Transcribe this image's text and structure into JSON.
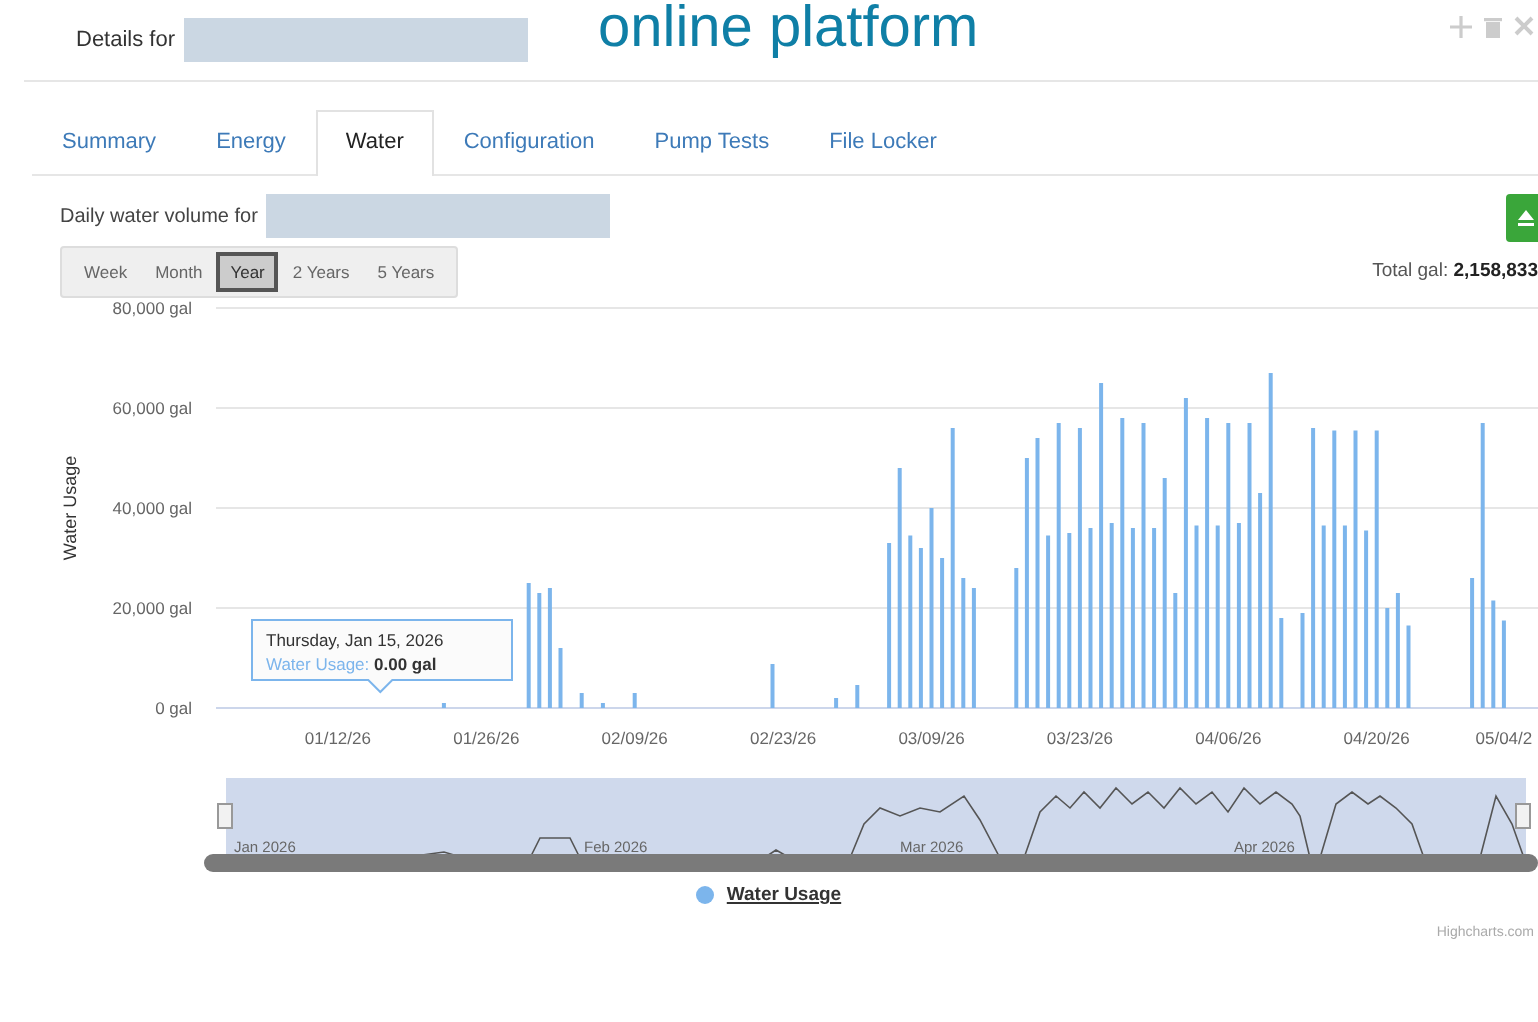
{
  "header": {
    "title": "Details for",
    "overlay_text": "online platform"
  },
  "tabs": [
    {
      "label": "Summary",
      "selected": false
    },
    {
      "label": "Energy",
      "selected": false
    },
    {
      "label": "Water",
      "selected": true
    },
    {
      "label": "Configuration",
      "selected": false
    },
    {
      "label": "Pump Tests",
      "selected": false
    },
    {
      "label": "File Locker",
      "selected": false
    }
  ],
  "subtitle": "Daily water volume for",
  "ranges": [
    {
      "label": "Week",
      "selected": false
    },
    {
      "label": "Month",
      "selected": false
    },
    {
      "label": "Year",
      "selected": true
    },
    {
      "label": "2 Years",
      "selected": false
    },
    {
      "label": "5 Years",
      "selected": false
    }
  ],
  "total": "Total gal: **2,158,833**",
  "chart_data": {
    "type": "bar",
    "ylabel": "Water Usage",
    "ylim": [
      0,
      80000
    ],
    "grid": true,
    "yticks": [
      {
        "value": 0,
        "label": "0 gal"
      },
      {
        "value": 20000,
        "label": "20,000 gal"
      },
      {
        "value": 40000,
        "label": "40,000 gal"
      },
      {
        "value": 60000,
        "label": "60,000 gal"
      },
      {
        "value": 80000,
        "label": "80,000 gal"
      }
    ],
    "categories": [
      null,
      null,
      null,
      null,
      null,
      null,
      null,
      null,
      null,
      null,
      null,
      "01/12/26",
      null,
      null,
      null,
      null,
      null,
      null,
      null,
      null,
      null,
      null,
      null,
      null,
      null,
      "01/26/26",
      null,
      null,
      null,
      null,
      null,
      null,
      null,
      null,
      null,
      null,
      null,
      null,
      null,
      "02/09/26",
      null,
      null,
      null,
      null,
      null,
      null,
      null,
      null,
      null,
      null,
      null,
      null,
      null,
      "02/23/26",
      null,
      null,
      null,
      null,
      null,
      null,
      null,
      null,
      null,
      null,
      null,
      null,
      null,
      "03/09/26",
      null,
      null,
      null,
      null,
      null,
      null,
      null,
      null,
      null,
      null,
      null,
      null,
      null,
      "03/23/26",
      null,
      null,
      null,
      null,
      null,
      null,
      null,
      null,
      null,
      null,
      null,
      null,
      null,
      "04/06/26",
      null,
      null,
      null,
      null,
      null,
      null,
      null,
      null,
      null,
      null,
      null,
      null,
      null,
      "04/20/26",
      null,
      null,
      null,
      null,
      null,
      null,
      null,
      null,
      null,
      null,
      null,
      "05/04/2",
      null,
      null
    ],
    "series": [
      {
        "name": "Water Usage",
        "color": "#7cb5ec",
        "values": [
          null,
          null,
          null,
          null,
          null,
          null,
          null,
          null,
          null,
          null,
          null,
          null,
          null,
          null,
          null,
          null,
          null,
          null,
          null,
          null,
          null,
          1000,
          null,
          null,
          null,
          null,
          null,
          null,
          null,
          25000,
          23000,
          24000,
          12000,
          null,
          3000,
          null,
          1000,
          null,
          null,
          3000,
          null,
          null,
          null,
          null,
          null,
          null,
          null,
          null,
          null,
          null,
          null,
          null,
          8800,
          null,
          null,
          null,
          null,
          null,
          2000,
          null,
          4600,
          null,
          null,
          33000,
          48000,
          34500,
          32000,
          40000,
          30000,
          56000,
          26000,
          24000,
          null,
          null,
          null,
          28000,
          50000,
          54000,
          34500,
          57000,
          35000,
          56000,
          36000,
          65000,
          37000,
          58000,
          36000,
          57000,
          36000,
          46000,
          23000,
          62000,
          36500,
          58000,
          36500,
          57000,
          37000,
          57000,
          43000,
          67000,
          18000,
          null,
          19000,
          56000,
          36500,
          55500,
          36500,
          55500,
          35500,
          55500,
          20000,
          23000,
          16500,
          null,
          null,
          null,
          null,
          null,
          26000,
          57000,
          21500,
          17500,
          null,
          null
        ]
      }
    ]
  },
  "tooltip": {
    "date": "Thursday, Jan 15, 2026",
    "series": "Water Usage:",
    "value": "0.00 gal"
  },
  "navigator_labels": [
    "Jan 2026",
    "Feb 2026",
    "Mar 2026",
    "Apr 2026"
  ],
  "credit": "Highcharts.com"
}
